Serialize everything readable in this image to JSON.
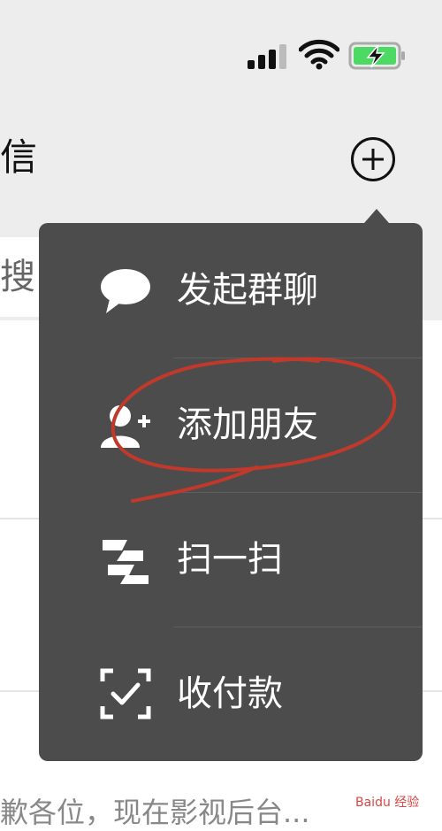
{
  "header": {
    "title_fragment": "信"
  },
  "search": {
    "placeholder_fragment": "搜索"
  },
  "menu": {
    "items": [
      {
        "label": "发起群聊",
        "icon": "chat-bubble-icon"
      },
      {
        "label": "添加朋友",
        "icon": "add-friend-icon"
      },
      {
        "label": "扫一扫",
        "icon": "scan-icon"
      },
      {
        "label": "收付款",
        "icon": "payment-icon"
      }
    ]
  },
  "list": {
    "preview_text": "歉各位，现在影视后台..."
  },
  "watermark": {
    "text": "Baidu 经验"
  },
  "colors": {
    "menu_bg": "#4c4c4c",
    "annotation": "#c0392b"
  }
}
